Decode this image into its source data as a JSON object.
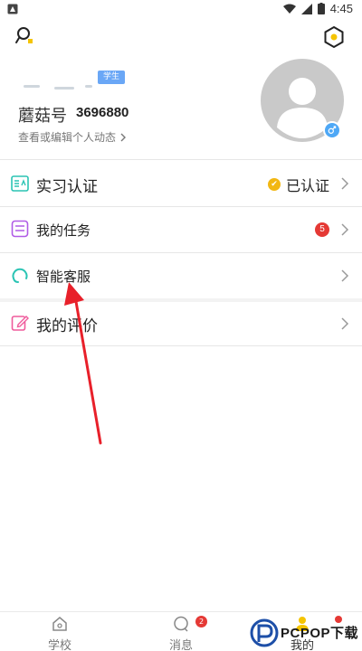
{
  "status_bar": {
    "time": "4:45"
  },
  "profile": {
    "badge": "学生",
    "mushroom_label": "蘑菇号",
    "mushroom_number": "3696880",
    "edit_link": "查看或编辑个人动态"
  },
  "menu": {
    "internship": {
      "label": "实习认证",
      "status": "已认证"
    },
    "tasks": {
      "label": "我的任务",
      "count": "5"
    },
    "service": {
      "label": "智能客服"
    },
    "evaluation": {
      "label": "我的评价"
    }
  },
  "bottom_nav": {
    "items": [
      {
        "label": "学校"
      },
      {
        "label": "消息",
        "badge": "2"
      },
      {
        "label": "我的"
      }
    ]
  },
  "watermark": {
    "text": "PCPOP下载"
  },
  "colors": {
    "accent_blue": "#6aa7f6",
    "badge_red": "#e53935",
    "verified_gold": "#f2b713",
    "arrow_red": "#e8202a"
  }
}
